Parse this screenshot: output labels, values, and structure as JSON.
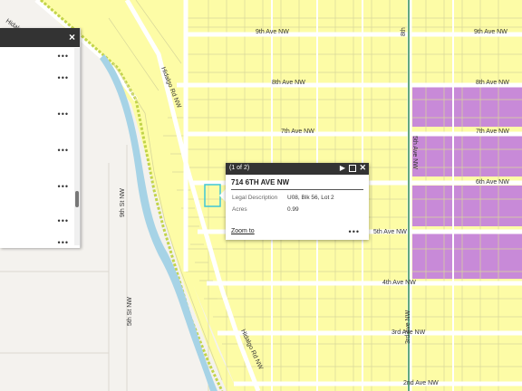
{
  "map": {
    "colors": {
      "parcel_fill": "#fdfca6",
      "parcel_line": "#d8d79a",
      "zoned": "#c88ad8",
      "road": "#ffffff",
      "water": "#a6d3e6",
      "highlight": "#3fc7d6",
      "railway": "#2e8b57",
      "trail": "#c2d44a"
    },
    "road_labels": {
      "ave9_a": "9th Ave NW",
      "ave9_b": "9th Ave NW",
      "ave8_a": "8th Ave NW",
      "ave8_b": "8th Ave NW",
      "ave7_a": "7th Ave NW",
      "ave7_b": "7th Ave NW",
      "ave6": "6th Ave NW",
      "ave5": "5th Ave NW",
      "ave4": "4th Ave NW",
      "ave3": "3rd Ave NW",
      "ave2": "2nd Ave NW",
      "hiawatha_top": "Hidalgo",
      "hiawatha_rd_a": "Hidalgo Rd NW",
      "hiawatha_rd_b": "Hidalgo Rd NW",
      "st_9th": "9th St NW",
      "st_5th": "5th St NW",
      "vert_right_a": "5th Ave NW",
      "vert_right_b": "3rd Ave NW",
      "top_right_v": "8th"
    }
  },
  "panel": {
    "close_icon": "×",
    "row_menu": "•••"
  },
  "popup": {
    "count": "(1 of 2)",
    "next_icon": "▶",
    "close_icon": "✕",
    "title": "714 6TH AVE NW",
    "fields": [
      {
        "label": "Legal Description",
        "value": "U08, Blk 56, Lot 2"
      },
      {
        "label": "Acres",
        "value": "0.99"
      }
    ],
    "zoom_label": "Zoom to",
    "more_icon": "•••"
  }
}
